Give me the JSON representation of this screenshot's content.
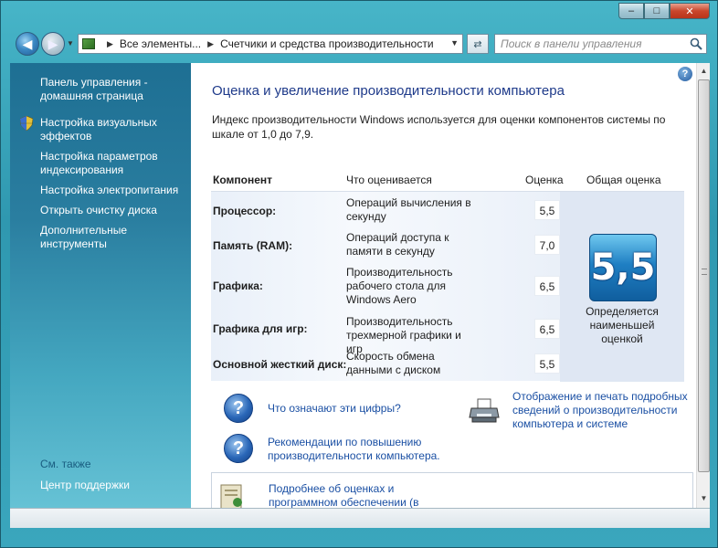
{
  "window": {
    "caption_buttons": {
      "minimize": "–",
      "maximize": "□",
      "close": "✕"
    }
  },
  "nav": {
    "back_icon": "arrow-left-icon",
    "forward_icon": "arrow-right-icon",
    "address_part1": "Все элементы...",
    "address_part2": "Счетчики и средства производительности",
    "search_placeholder": "Поиск в панели управления"
  },
  "sidebar": {
    "items": [
      {
        "label": "Панель управления - домашняя страница"
      },
      {
        "label": "Настройка визуальных эффектов",
        "icon": "shield-icon"
      },
      {
        "label": "Настройка параметров индексирования"
      },
      {
        "label": "Настройка электропитания"
      },
      {
        "label": "Открыть очистку диска"
      },
      {
        "label": "Дополнительные инструменты"
      }
    ],
    "see_also": "См. также",
    "support": "Центр поддержки"
  },
  "main": {
    "help": "?",
    "title": "Оценка и увеличение производительности компьютера",
    "description": "Индекс производительности Windows используется для оценки компонентов системы по шкале от 1,0 до 7,9.",
    "headers": {
      "component": "Компонент",
      "what": "Что оценивается",
      "score": "Оценка",
      "overall": "Общая оценка"
    },
    "rows": [
      {
        "name": "Процессор:",
        "desc": "Операций вычисления в секунду",
        "score": "5,5"
      },
      {
        "name": "Память (RAM):",
        "desc": "Операций доступа к памяти в секунду",
        "score": "7,0"
      },
      {
        "name": "Графика:",
        "desc": "Производительность рабочего стола для Windows Aero",
        "score": "6,5"
      },
      {
        "name": "Графика для игр:",
        "desc": "Производительность трехмерной графики и игр",
        "score": "6,5"
      },
      {
        "name": "Основной жесткий диск:",
        "desc": "Скорость обмена данными с диском",
        "score": "5,5"
      }
    ],
    "overall_value": "5,5",
    "overall_note": "Определяется наименьшей оценкой",
    "links": {
      "what_mean": "Что означают эти цифры?",
      "recommend": "Рекомендации по повышению производительности компьютера.",
      "print": "Отображение и печать подробных сведений о производительности компьютера и системе",
      "more": "Подробнее об оценках и программном обеспечении (в"
    }
  }
}
